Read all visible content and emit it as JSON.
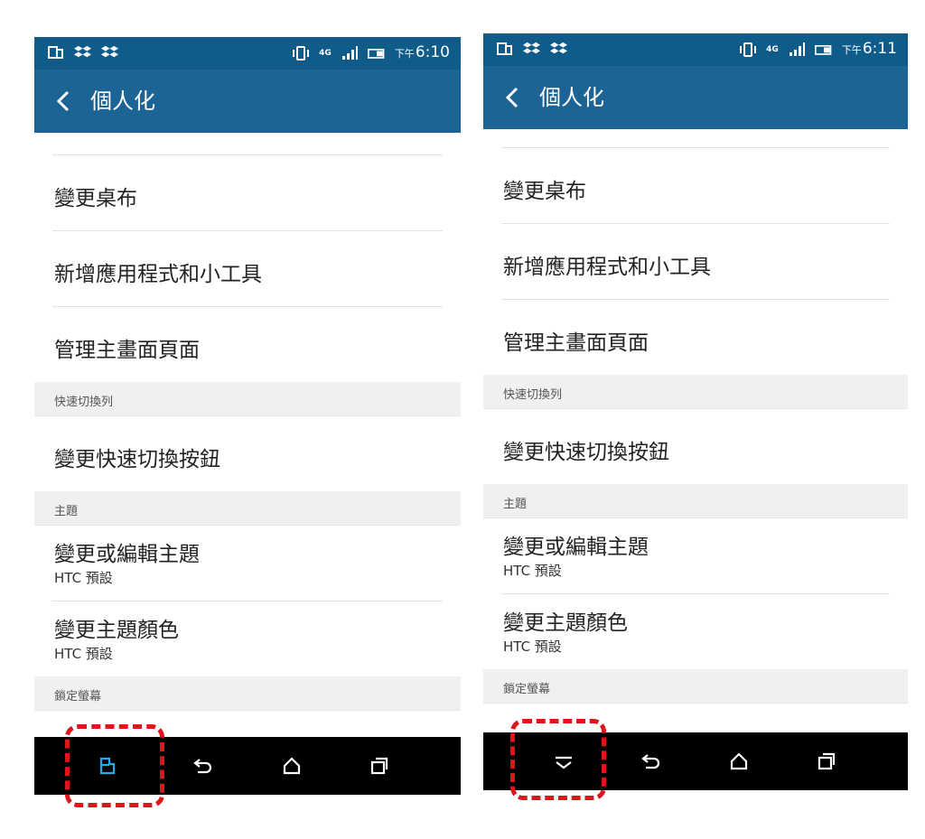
{
  "screens": [
    {
      "status_time_prefix": "下午",
      "status_time": "6:10",
      "network": "4G",
      "title": "個人化",
      "items": {
        "wallpaper": "變更桌布",
        "add_apps": "新增應用程式和小工具",
        "manage_home": "管理主畫面頁面",
        "quick_section": "快速切換列",
        "quick_toggle": "變更快速切換按鈕",
        "theme_section": "主題",
        "edit_theme": "變更或編輯主題",
        "edit_theme_sub": "HTC 預設",
        "theme_color": "變更主題顏色",
        "theme_color_sub": "HTC 預設",
        "lock_section": "鎖定螢幕"
      },
      "nav_left_icon": "recents-app-icon"
    },
    {
      "status_time_prefix": "下午",
      "status_time": "6:11",
      "network": "4G",
      "title": "個人化",
      "items": {
        "wallpaper": "變更桌布",
        "add_apps": "新增應用程式和小工具",
        "manage_home": "管理主畫面頁面",
        "quick_section": "快速切換列",
        "quick_toggle": "變更快速切換按鈕",
        "theme_section": "主題",
        "edit_theme": "變更或編輯主題",
        "edit_theme_sub": "HTC 預設",
        "theme_color": "變更主題顏色",
        "theme_color_sub": "HTC 預設",
        "lock_section": "鎖定螢幕"
      },
      "nav_left_icon": "hide-keyboard-chevron-icon"
    }
  ],
  "colors": {
    "statusbar": "#0f5b8a",
    "actionbar": "#1c6496",
    "highlight": "#e0141b",
    "nav_accent": "#2ba8e6"
  }
}
